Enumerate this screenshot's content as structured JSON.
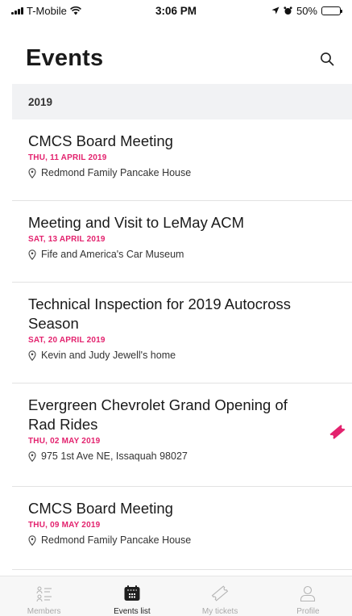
{
  "status": {
    "carrier": "T-Mobile",
    "time": "3:06 PM",
    "battery": "50%"
  },
  "header": {
    "title": "Events"
  },
  "section": {
    "label": "2019"
  },
  "events": [
    {
      "title": "CMCS Board Meeting",
      "date": "THU, 11 APRIL 2019",
      "location": "Redmond Family Pancake House",
      "has_ticket": false
    },
    {
      "title": "Meeting and Visit to LeMay ACM",
      "date": "SAT, 13 APRIL 2019",
      "location": "Fife and America's Car Museum",
      "has_ticket": false
    },
    {
      "title": "Technical Inspection for 2019 Autocross Season",
      "date": "SAT, 20 APRIL 2019",
      "location": "Kevin and Judy Jewell's home",
      "has_ticket": false
    },
    {
      "title": "Evergreen Chevrolet Grand Opening of Rad Rides",
      "date": "THU, 02 MAY 2019",
      "location": "975 1st Ave NE, Issaquah 98027",
      "has_ticket": true
    },
    {
      "title": "CMCS Board Meeting",
      "date": "THU, 09 MAY 2019",
      "location": "Redmond Family Pancake House",
      "has_ticket": false
    }
  ],
  "tabs": [
    {
      "label": "Members",
      "icon": "members-list-icon",
      "active": false
    },
    {
      "label": "Events list",
      "icon": "calendar-icon",
      "active": true
    },
    {
      "label": "My tickets",
      "icon": "ticket-icon",
      "active": false
    },
    {
      "label": "Profile",
      "icon": "person-icon",
      "active": false
    }
  ],
  "colors": {
    "accent": "#e3226e",
    "section_bg": "#f1f2f4",
    "tab_bar_bg": "#f7f7f7"
  }
}
